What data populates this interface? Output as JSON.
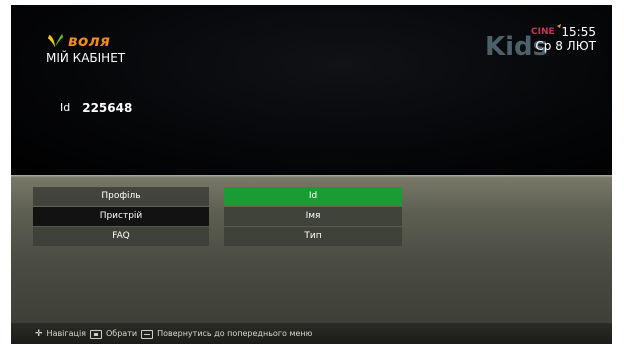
{
  "header": {
    "brand": "воля",
    "page_title": "МІЙ КАБІНЕТ",
    "channel_logo": "Kids CINE",
    "time": "15:55",
    "date": "Ср 8 ЛЮТ"
  },
  "account": {
    "id_label": "Id",
    "id_value": "225648"
  },
  "menu": {
    "items": [
      {
        "label": "Профіль"
      },
      {
        "label": "Пристрій"
      },
      {
        "label": "FAQ"
      }
    ]
  },
  "submenu": {
    "items": [
      {
        "label": "Id"
      },
      {
        "label": "Імя"
      },
      {
        "label": "Тип"
      }
    ]
  },
  "footer": {
    "nav_label": "Навігація",
    "select_label": "Обрати",
    "back_label": "Повернутись до попереднього меню"
  },
  "colors": {
    "brand_orange": "#f28c1a",
    "selected_green": "#1a9c35"
  },
  "icons": [
    "volia-logo-icon",
    "kids-cine-logo",
    "dpad-icon",
    "ok-button-icon",
    "back-button-icon"
  ]
}
